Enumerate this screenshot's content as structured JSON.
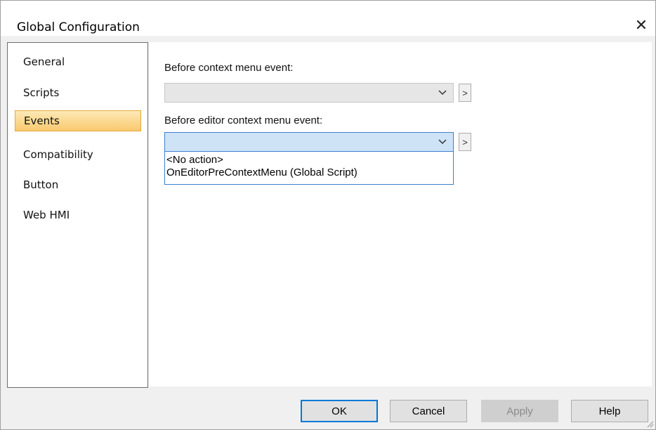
{
  "window": {
    "title": "Global Configuration",
    "close_glyph": "✕"
  },
  "sidebar": {
    "items": [
      {
        "label": "General",
        "active": false
      },
      {
        "label": "Scripts",
        "active": false
      },
      {
        "label": "Events",
        "active": true
      },
      {
        "label": "Compatibility",
        "active": false
      },
      {
        "label": "Button",
        "active": false
      },
      {
        "label": "Web HMI",
        "active": false
      }
    ]
  },
  "events": {
    "context_menu": {
      "label": "Before context menu event:",
      "value": "",
      "browse": ">"
    },
    "editor_context_menu": {
      "label": "Before editor context menu event:",
      "value": "",
      "browse": ">",
      "expanded": true,
      "options": [
        "<No action>",
        "OnEditorPreContextMenu (Global Script)"
      ]
    }
  },
  "footer": {
    "ok": "OK",
    "cancel": "Cancel",
    "apply": "Apply",
    "help": "Help"
  },
  "colors": {
    "selection": "#f9c96e",
    "focus": "#3c7fd0"
  }
}
